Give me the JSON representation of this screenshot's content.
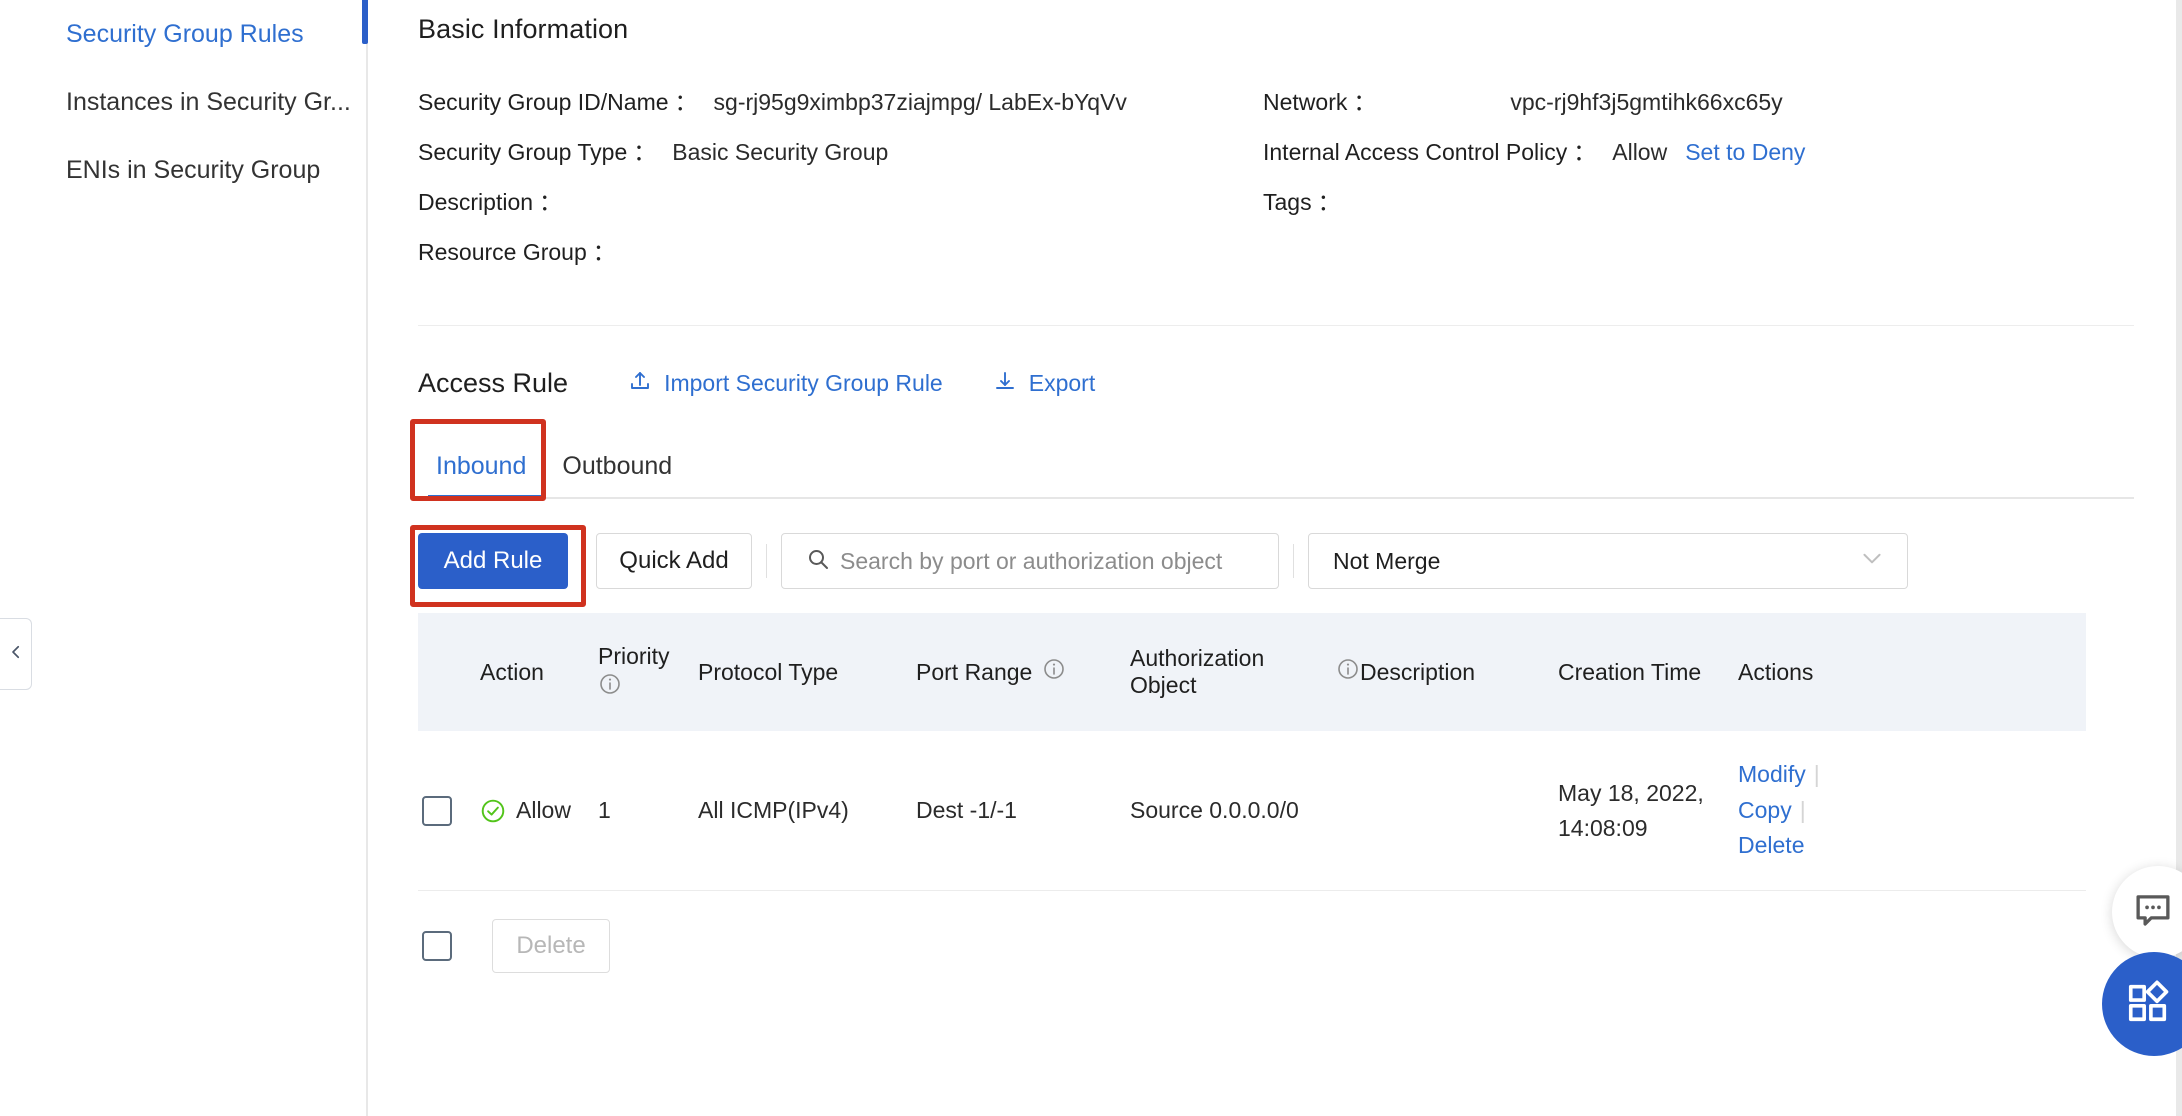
{
  "sidebar": {
    "items": [
      {
        "label": "Security Group Rules",
        "active": true
      },
      {
        "label": "Instances in Security Gr...",
        "active": false
      },
      {
        "label": "ENIs in Security Group",
        "active": false
      }
    ],
    "collapse_icon": "chevron-left-icon"
  },
  "basic_information": {
    "title": "Basic Information",
    "fields": [
      {
        "label": "Security Group ID/Name",
        "colon": "：",
        "value": "sg-rj95g9ximbp37ziajmpg/ LabEx-bYqVv"
      },
      {
        "label": "Network",
        "colon": "：",
        "value": "vpc-rj9hf3j5gmtihk66xc65y"
      },
      {
        "label": "Security Group Type",
        "colon": "：",
        "value": "Basic Security Group"
      },
      {
        "label": "Internal Access Control Policy",
        "colon": "：",
        "value": "Allow",
        "link": "Set to Deny"
      },
      {
        "label": "Description",
        "colon": "：",
        "value": ""
      },
      {
        "label": "Tags",
        "colon": "：",
        "value": ""
      },
      {
        "label": "Resource Group",
        "colon": "：",
        "value": ""
      }
    ]
  },
  "access_rule": {
    "title": "Access Rule",
    "import_label": "Import Security Group Rule",
    "import_icon": "upload-icon",
    "export_label": "Export",
    "export_icon": "download-icon",
    "tabs": [
      {
        "label": "Inbound",
        "active": true,
        "highlighted": true
      },
      {
        "label": "Outbound",
        "active": false,
        "highlighted": false
      }
    ],
    "controls": {
      "add_rule_label": "Add Rule",
      "add_rule_highlighted": true,
      "quick_add_label": "Quick Add",
      "search_placeholder": "Search by port or authorization object",
      "search_value": "",
      "search_icon": "search-icon",
      "merge_select_value": "Not Merge",
      "merge_select_icon": "chevron-down-icon"
    },
    "table": {
      "columns": [
        {
          "key": "checkbox",
          "label": ""
        },
        {
          "key": "action",
          "label": "Action",
          "info": false
        },
        {
          "key": "priority",
          "label": "Priority",
          "info": true
        },
        {
          "key": "protocol_type",
          "label": "Protocol Type",
          "info": false
        },
        {
          "key": "port_range",
          "label": "Port Range",
          "info": true
        },
        {
          "key": "authorization_object",
          "label": "Authorization Object",
          "info": true
        },
        {
          "key": "description",
          "label": "Description",
          "info": false
        },
        {
          "key": "creation_time",
          "label": "Creation Time",
          "info": false
        },
        {
          "key": "actions",
          "label": "Actions",
          "info": false
        }
      ],
      "rows": [
        {
          "selected": false,
          "action": "Allow",
          "action_icon": "check-circle-icon",
          "priority": "1",
          "protocol_type": "All ICMP(IPv4)",
          "port_range": "Dest -1/-1",
          "authorization_object": "Source 0.0.0.0/0",
          "description": "",
          "creation_time_line1": "May 18, 2022,",
          "creation_time_line2": "14:08:09",
          "actions": [
            "Modify",
            "Copy",
            "Delete"
          ]
        }
      ]
    },
    "footer": {
      "select_all_checked": false,
      "delete_label": "Delete",
      "delete_disabled": true
    }
  },
  "floating": {
    "chat_icon": "chat-bubble-icon",
    "apps_icon": "apps-grid-icon"
  },
  "colors": {
    "primary": "#2b5fc9",
    "link": "#2f6fd0",
    "highlight": "#d0321f",
    "success": "#52c41a",
    "header_bg": "#f0f3f8"
  }
}
